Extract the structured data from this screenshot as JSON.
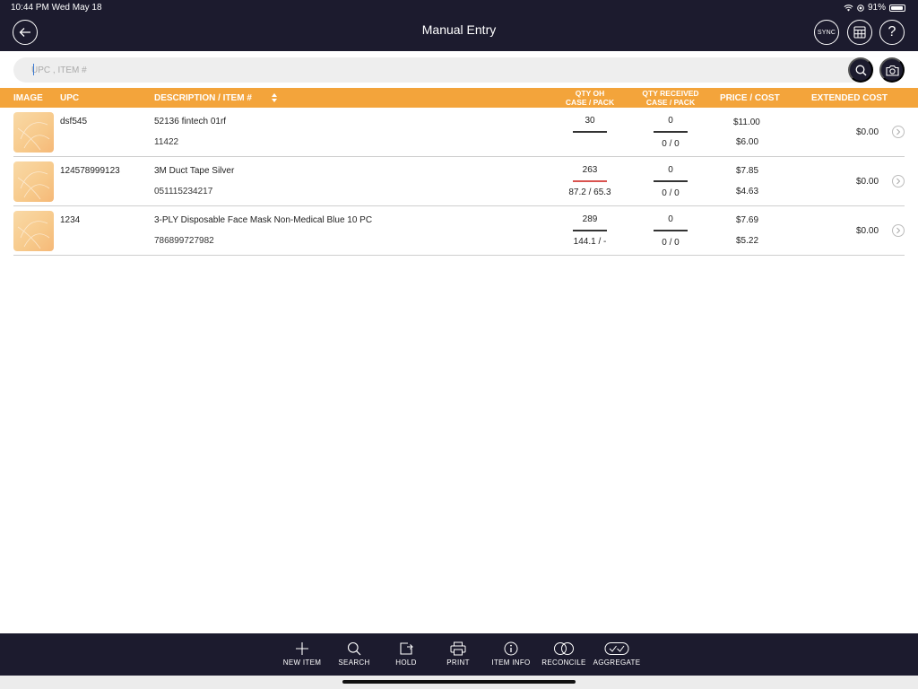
{
  "status": {
    "time_date": "10:44 PM  Wed May 18",
    "battery": "91%"
  },
  "header": {
    "title": "Manual Entry",
    "sync_label": "SYNC",
    "help_label": "?"
  },
  "search": {
    "placeholder": "UPC , ITEM #"
  },
  "table": {
    "columns": {
      "image": "IMAGE",
      "upc": "UPC",
      "description": "DESCRIPTION / ITEM #",
      "qty_oh_1": "QTY OH",
      "qty_oh_2": "CASE / PACK",
      "qty_recv_1": "QTY RECEIVED",
      "qty_recv_2": "CASE / PACK",
      "price_cost": "PRICE / COST",
      "extended_cost": "EXTENDED COST"
    },
    "rows": [
      {
        "upc": "dsf545",
        "description": "52136 fintech 01rf",
        "item_no": "11422",
        "qty_oh": "30",
        "qty_oh_case_pack": "",
        "qty_received": "0",
        "qty_received_case_pack": "0 / 0",
        "price": "$11.00",
        "cost": "$6.00",
        "extended_cost": "$0.00"
      },
      {
        "upc": "124578999123",
        "description": "3M Duct Tape Silver",
        "item_no": "051115234217",
        "qty_oh": "263",
        "qty_oh_case_pack": "87.2 / 65.3",
        "qty_received": "0",
        "qty_received_case_pack": "0 / 0",
        "price": "$7.85",
        "cost": "$4.63",
        "extended_cost": "$0.00"
      },
      {
        "upc": "1234",
        "description": "3-PLY Disposable Face Mask Non-Medical Blue 10 PC",
        "item_no": "786899727982",
        "qty_oh": "289",
        "qty_oh_case_pack": "144.1 / -",
        "qty_received": "0",
        "qty_received_case_pack": "0 / 0",
        "price": "$7.69",
        "cost": "$5.22",
        "extended_cost": "$0.00"
      }
    ]
  },
  "toolbar": {
    "new_item": "NEW ITEM",
    "search": "SEARCH",
    "hold": "HOLD",
    "print": "PRINT",
    "item_info": "ITEM INFO",
    "reconcile": "RECONCILE",
    "aggregate": "AGGREGATE"
  },
  "colors": {
    "header_bg": "#1c1b2e",
    "accent": "#f3a43b",
    "warn_line": "#d9534f"
  }
}
